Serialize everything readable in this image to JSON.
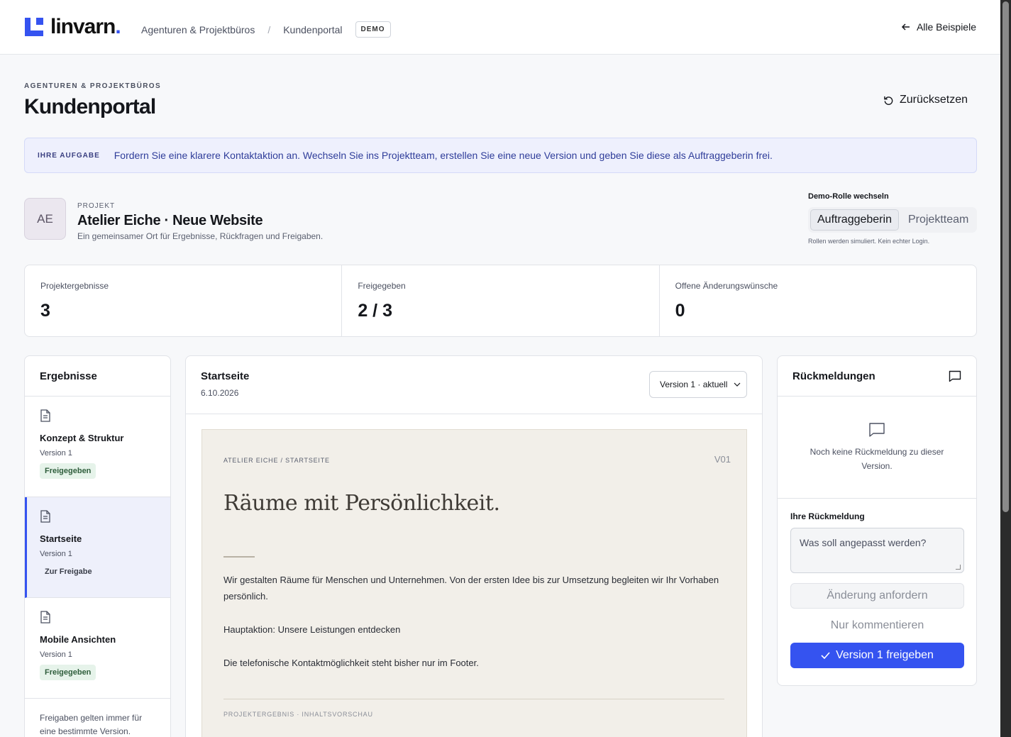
{
  "topbar": {
    "brand": "linvarn",
    "brand_dot": ".",
    "breadcrumb": [
      "Agenturen & Projektbüros",
      "Kundenportal"
    ],
    "badge": "DEMO",
    "back_label": "Alle Beispiele"
  },
  "header": {
    "eyebrow": "AGENTUREN & PROJEKTBÜROS",
    "title": "Kundenportal",
    "reset_label": "Zurücksetzen"
  },
  "task": {
    "label": "IHRE AUFGABE",
    "text": "Fordern Sie eine klarere Kontaktaktion an. Wechseln Sie ins Projektteam, erstellen Sie eine neue Version und geben Sie diese als Auftraggeberin frei."
  },
  "project": {
    "initials": "AE",
    "eyebrow": "PROJEKT",
    "title": "Atelier Eiche · Neue Website",
    "subtitle": "Ein gemeinsamer Ort für Ergebnisse, Rückfragen und Freigaben."
  },
  "role": {
    "label": "Demo-Rolle wechseln",
    "options": [
      "Auftraggeberin",
      "Projektteam"
    ],
    "selected": "Auftraggeberin",
    "note": "Rollen werden simuliert. Kein echter Login."
  },
  "stats": [
    {
      "label": "Projektergebnisse",
      "value": "3"
    },
    {
      "label": "Freigegeben",
      "value": "2 / 3"
    },
    {
      "label": "Offene Änderungswünsche",
      "value": "0"
    }
  ],
  "results": {
    "title": "Ergebnisse",
    "items": [
      {
        "title": "Konzept & Struktur",
        "version": "Version 1",
        "status": "Freigegeben"
      },
      {
        "title": "Startseite",
        "version": "Version 1",
        "status": "Zur Freigabe"
      },
      {
        "title": "Mobile Ansichten",
        "version": "Version 1",
        "status": "Freigegeben"
      }
    ],
    "note": "Freigaben gelten immer für eine bestimmte Version."
  },
  "detail": {
    "title": "Startseite",
    "date": "6.10.2026",
    "version_select": "Version 1 · aktuell",
    "preview": {
      "eyebrow": "ATELIER EICHE / STARTSEITE",
      "version": "V01",
      "headline": "Räume mit Persönlichkeit.",
      "intro": "Wir gestalten Räume für Menschen und Unternehmen. Von der ersten Idee bis zur Umsetzung begleiten wir Ihr Vorhaben persönlich.",
      "cta": "Hauptaktion: Unsere Leistungen entdecken",
      "contact": "Die telefonische Kontaktmöglichkeit steht bisher nur im Footer.",
      "footer": "PROJEKTERGEBNIS · INHALTSVORSCHAU"
    }
  },
  "feedback": {
    "title": "Rückmeldungen",
    "empty": "Noch keine Rückmeldung zu dieser Version.",
    "form_label": "Ihre Rückmeldung",
    "placeholder": "Was soll angepasst werden?",
    "request_label": "Änderung anfordern",
    "comment_label": "Nur kommentieren",
    "approve_label": "Version 1 freigeben"
  },
  "colors": {
    "accent": "#3553f0",
    "banner_bg": "#eef0fd",
    "approved_bg": "#e6f3ea"
  }
}
